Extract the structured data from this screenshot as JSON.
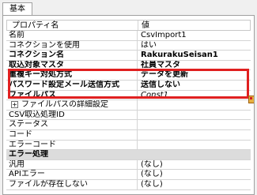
{
  "tab": {
    "label": "基本"
  },
  "headers": {
    "property": "プロパティ名",
    "value": "値"
  },
  "rows": [
    {
      "name": "名前",
      "value": "CsvImport1",
      "style": "normal"
    },
    {
      "name": "コネクションを使用",
      "value": "はい",
      "style": "normal"
    },
    {
      "name": "コネクション名",
      "value": "RakurakuSeisan1",
      "style": "bold"
    },
    {
      "name": "取込対象マスタ",
      "value": "社員マスタ",
      "style": "bold"
    },
    {
      "name": "重複キー対処方式",
      "value": "データを更新",
      "style": "bold"
    },
    {
      "name": "パスワード設定メール送信方式",
      "value": "送信しない",
      "style": "bold"
    },
    {
      "name": "ファイルパス",
      "value": "Const1",
      "style": "bold-italic-value"
    },
    {
      "name": "ファイルパスの詳細設定",
      "value": "",
      "style": "expandable",
      "expander": "+"
    },
    {
      "name": "CSV取込処理ID",
      "value": "",
      "style": "normal"
    },
    {
      "name": "ステータス",
      "value": "",
      "style": "normal"
    },
    {
      "name": "コード",
      "value": "",
      "style": "normal"
    },
    {
      "name": "エラーコード",
      "value": "",
      "style": "normal"
    },
    {
      "name": "エラー処理",
      "value": "",
      "style": "category"
    },
    {
      "name": "汎用",
      "value": "(なし)",
      "style": "normal"
    },
    {
      "name": "APIエラー",
      "value": "(なし)",
      "style": "normal"
    },
    {
      "name": "ファイルが存在しない",
      "value": "(なし)",
      "style": "normal"
    }
  ],
  "icons": {
    "browse": "file-browse-icon"
  },
  "colors": {
    "highlight": "#e02020",
    "category_bg": "#dcdcdc"
  }
}
